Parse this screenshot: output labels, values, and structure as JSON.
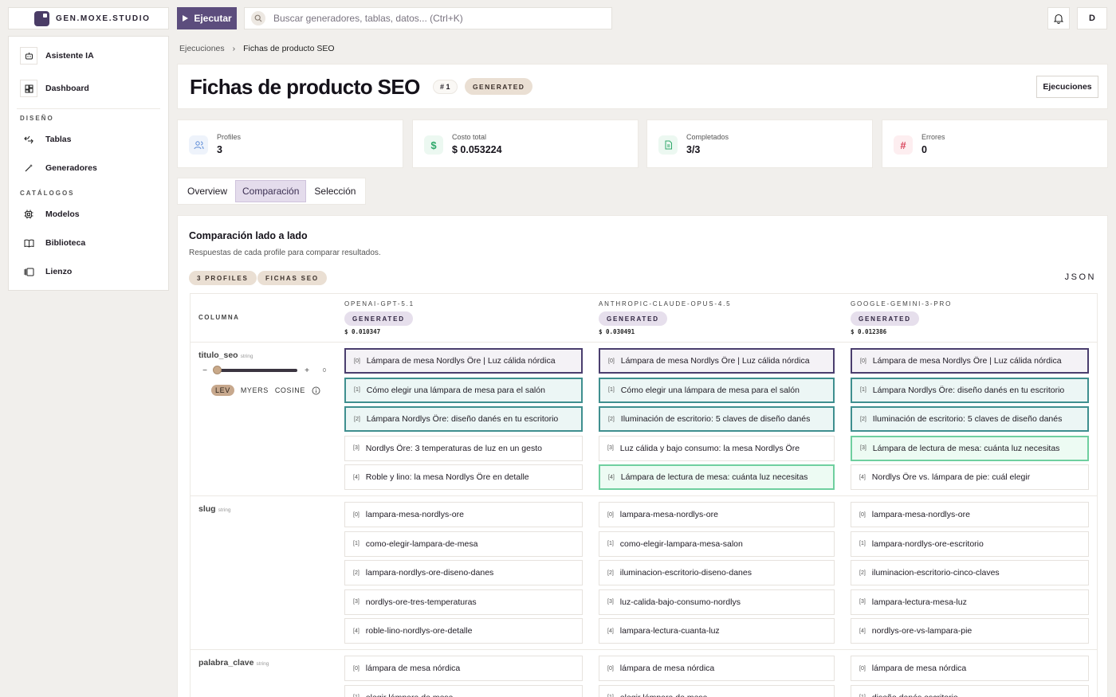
{
  "app": {
    "brand": "GEN.MOXE.STUDIO",
    "run_label": "Ejecutar",
    "search_placeholder": "Buscar generadores, tablas, datos... (Ctrl+K)",
    "avatar": "D"
  },
  "sidebar": {
    "top_items": [
      {
        "label": "Asistente IA",
        "icon": "bot-icon"
      },
      {
        "label": "Dashboard",
        "icon": "dashboard-icon"
      }
    ],
    "design_heading": "DISEÑO",
    "design_items": [
      {
        "label": "Tablas",
        "icon": "tables-icon"
      },
      {
        "label": "Generadores",
        "icon": "wand-icon"
      }
    ],
    "catalog_heading": "CATÁLOGOS",
    "catalog_items": [
      {
        "label": "Modelos",
        "icon": "chip-icon"
      },
      {
        "label": "Biblioteca",
        "icon": "book-icon"
      },
      {
        "label": "Lienzo",
        "icon": "canvas-icon"
      }
    ]
  },
  "breadcrumb": {
    "parent": "Ejecuciones",
    "current": "Fichas de producto SEO"
  },
  "header": {
    "title": "Fichas de producto SEO",
    "run_number": "# 1",
    "status": "GENERATED",
    "ejecuciones_button": "Ejecuciones"
  },
  "stats": [
    {
      "label": "Profiles",
      "value": "3",
      "icon": "users-icon",
      "color": "#5b8ad6",
      "bg": "#eef3fb"
    },
    {
      "label": "Costo total",
      "value": "$ 0.053224",
      "icon": "dollar-icon",
      "color": "#2fa86a",
      "bg": "#ecf8f1"
    },
    {
      "label": "Completados",
      "value": "3/3",
      "icon": "doc-icon",
      "color": "#2fa86a",
      "bg": "#ecf8f1"
    },
    {
      "label": "Errores",
      "value": "0",
      "icon": "hash-icon",
      "color": "#d9455c",
      "bg": "#fdeef0"
    }
  ],
  "tabs": [
    "Overview",
    "Comparación",
    "Selección"
  ],
  "active_tab": "Comparación",
  "comparison": {
    "title": "Comparación lado a lado",
    "subtitle": "Respuestas de cada profile para comparar resultados.",
    "chips": [
      "3 PROFILES",
      "FICHAS SEO"
    ],
    "json_label": "JSON",
    "column_header": "COLUMNA",
    "similarity": {
      "value": "0",
      "algorithms": [
        "LEV",
        "MYERS",
        "COSINE"
      ],
      "active_algorithm": "LEV"
    },
    "models": [
      {
        "name": "OPENAI-GPT-5.1",
        "status": "GENERATED",
        "cost": "$ 0.010347"
      },
      {
        "name": "ANTHROPIC-CLAUDE-OPUS-4.5",
        "status": "GENERATED",
        "cost": "$ 0.030491"
      },
      {
        "name": "GOOGLE-GEMINI-3-PRO",
        "status": "GENERATED",
        "cost": "$ 0.012386"
      }
    ],
    "fields": [
      {
        "name": "titulo_seo",
        "type": "string",
        "values": [
          [
            "Lámpara de mesa Nordlys Öre | Luz cálida nórdica",
            "Cómo elegir una lámpara de mesa para el salón",
            "Lámpara Nordlys Öre: diseño danés en tu escritorio",
            "Nordlys Öre: 3 temperaturas de luz en un gesto",
            "Roble y lino: la mesa Nordlys Öre en detalle"
          ],
          [
            "Lámpara de mesa Nordlys Öre | Luz cálida nórdica",
            "Cómo elegir una lámpara de mesa para el salón",
            "Iluminación de escritorio: 5 claves de diseño danés",
            "Luz cálida y bajo consumo: la mesa Nordlys Öre",
            "Lámpara de lectura de mesa: cuánta luz necesitas"
          ],
          [
            "Lámpara de mesa Nordlys Öre | Luz cálida nórdica",
            "Lámpara Nordlys Öre: diseño danés en tu escritorio",
            "Iluminación de escritorio: 5 claves de diseño danés",
            "Lámpara de lectura de mesa: cuánta luz necesitas",
            "Nordlys Öre vs. lámpara de pie: cuál elegir"
          ]
        ]
      },
      {
        "name": "slug",
        "type": "string",
        "values": [
          [
            "lampara-mesa-nordlys-ore",
            "como-elegir-lampara-de-mesa",
            "lampara-nordlys-ore-diseno-danes",
            "nordlys-ore-tres-temperaturas",
            "roble-lino-nordlys-ore-detalle"
          ],
          [
            "lampara-mesa-nordlys-ore",
            "como-elegir-lampara-mesa-salon",
            "iluminacion-escritorio-diseno-danes",
            "luz-calida-bajo-consumo-nordlys",
            "lampara-lectura-cuanta-luz"
          ],
          [
            "lampara-mesa-nordlys-ore",
            "lampara-nordlys-ore-escritorio",
            "iluminacion-escritorio-cinco-claves",
            "lampara-lectura-mesa-luz",
            "nordlys-ore-vs-lampara-pie"
          ]
        ]
      },
      {
        "name": "palabra_clave",
        "type": "string",
        "values": [
          [
            "lámpara de mesa nórdica",
            "elegir lámpara de mesa"
          ],
          [
            "lámpara de mesa nórdica",
            "elegir lámpara de mesa"
          ],
          [
            "lámpara de mesa nórdica",
            "diseño danés escritorio"
          ]
        ]
      }
    ]
  }
}
